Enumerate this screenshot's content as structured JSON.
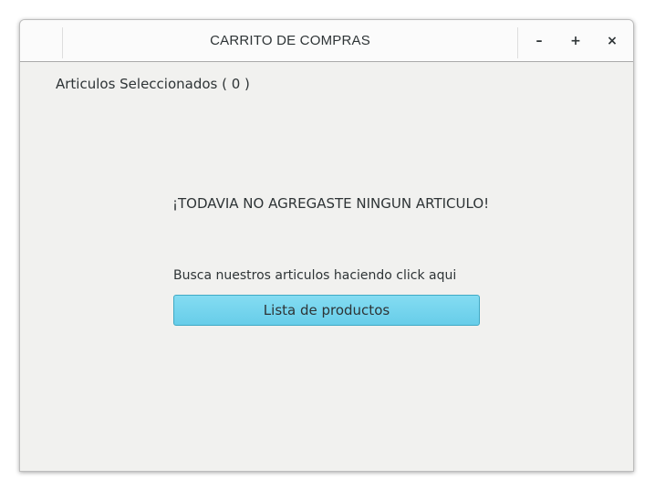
{
  "window": {
    "title": "CARRITO DE COMPRAS",
    "minimize_glyph": "–",
    "maximize_glyph": "+",
    "close_glyph": "×"
  },
  "cart": {
    "selected_label": "Articulos Seleccionados ( 0 )",
    "empty_message": "¡TODAVIA NO AGREGASTE NINGUN ARTICULO!",
    "hint": "Busca nuestros articulos haciendo click aqui",
    "products_button_label": "Lista de productos"
  },
  "colors": {
    "button_fill": "#6fd2ec",
    "button_border": "#3fa9c4",
    "window_bg": "#f1f1ef",
    "text": "#2e3436"
  },
  "icons": {
    "minimize": "minimize-icon",
    "maximize": "maximize-icon",
    "close": "close-icon"
  }
}
